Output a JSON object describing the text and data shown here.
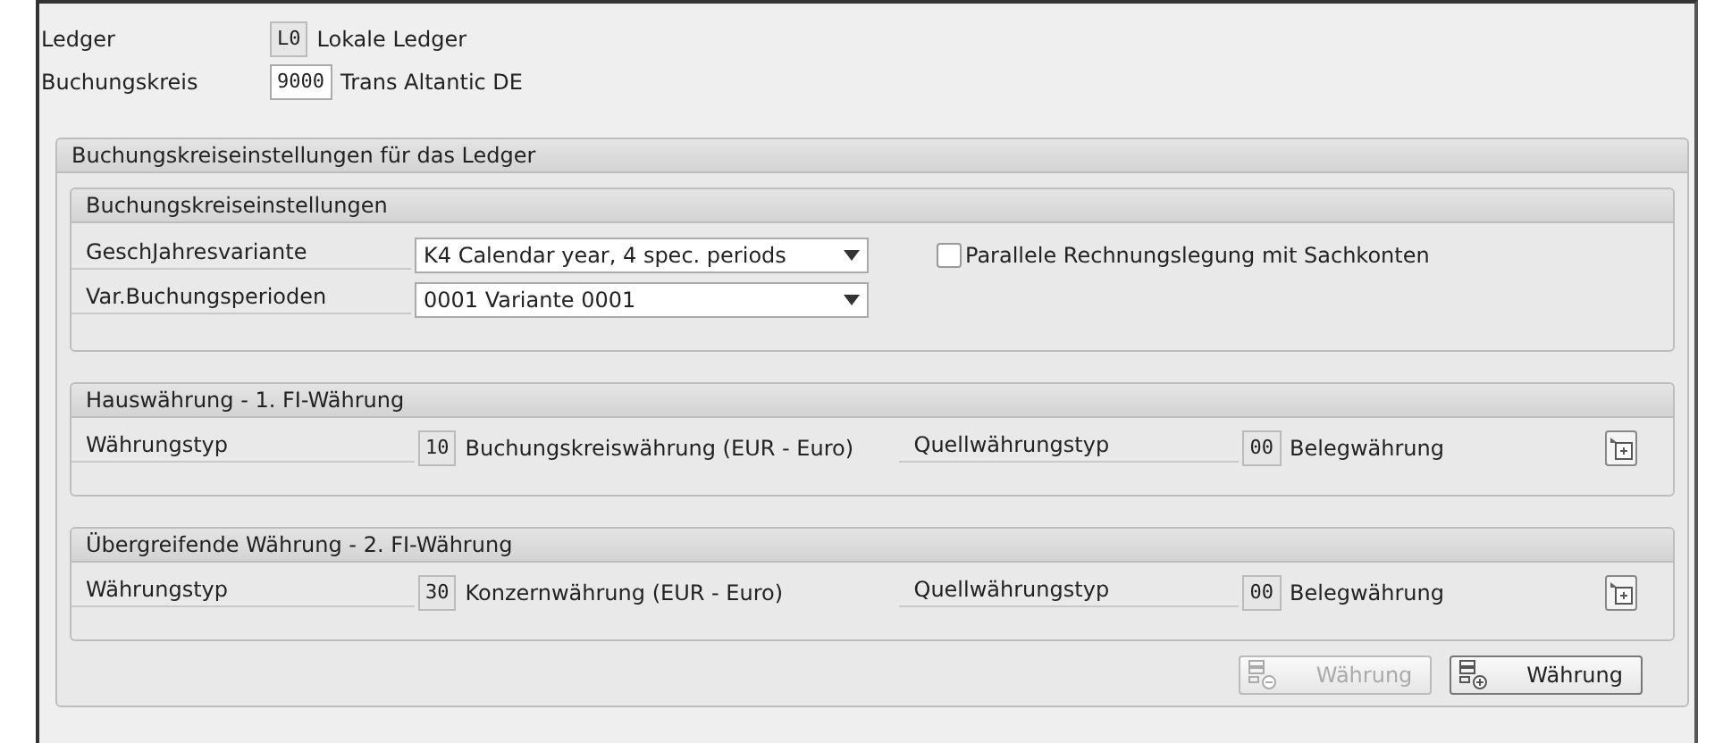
{
  "header_fields": [
    {
      "label": "Ledger",
      "value": "L0",
      "description": "Lokale Ledger",
      "editable": false
    },
    {
      "label": "Buchungskreis",
      "value": "9000",
      "description": "Trans Altantic DE",
      "editable": true
    }
  ],
  "ledger_settings": {
    "title": "Buchungskreiseinstellungen für das Ledger",
    "company_settings": {
      "title": "Buchungskreiseinstellungen",
      "dropdowns": [
        {
          "label": "GeschJahresvariante",
          "value": "K4 Calendar year, 4 spec. periods"
        },
        {
          "label": "Var.Buchungsperioden",
          "value": "0001 Variante 0001"
        }
      ],
      "checkbox": {
        "label": "Parallele Rechnungslegung mit Sachkonten",
        "checked": false
      }
    },
    "currencies": [
      {
        "title": "Hauswährung - 1. FI-Währung",
        "type_label": "Währungstyp",
        "type_value": "10",
        "type_description": "Buchungskreiswährung (EUR - Euro)",
        "source_label": "Quellwährungstyp",
        "source_value": "00",
        "source_description": "Belegwährung"
      },
      {
        "title": "Übergreifende Währung - 2. FI-Währung",
        "type_label": "Währungstyp",
        "type_value": "30",
        "type_description": "Konzernwährung (EUR - Euro)",
        "source_label": "Quellwährungstyp",
        "source_value": "00",
        "source_description": "Belegwährung"
      }
    ],
    "buttons": [
      {
        "kind": "remove",
        "label": "Währung",
        "disabled": true
      },
      {
        "kind": "add",
        "label": "Währung",
        "disabled": false
      }
    ]
  }
}
